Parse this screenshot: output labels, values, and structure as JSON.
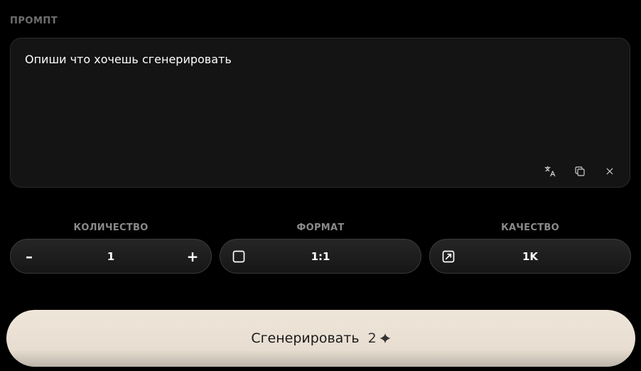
{
  "prompt": {
    "section_label": "ПРОМПТ",
    "placeholder": "Опиши что хочешь сгенерировать",
    "value": "",
    "tools": {
      "translate_icon": "translate-icon",
      "copy_icon": "copy-icon",
      "clear_icon": "close-icon"
    }
  },
  "controls": {
    "quantity": {
      "label": "КОЛИЧЕСТВО",
      "value": "1",
      "decrement": "–",
      "increment": "+"
    },
    "format": {
      "label": "ФОРМАТ",
      "value": "1:1",
      "icon": "square-icon"
    },
    "quality": {
      "label": "КАЧЕСТВО",
      "value": "1K",
      "icon": "resize-icon"
    }
  },
  "generate": {
    "label": "Сгенерировать",
    "cost": "2",
    "cost_icon": "sparkle-icon"
  },
  "colors": {
    "background": "#000000",
    "panel": "#141414",
    "button_light": "#e9e0d4",
    "label_muted": "#8a8a8a"
  }
}
